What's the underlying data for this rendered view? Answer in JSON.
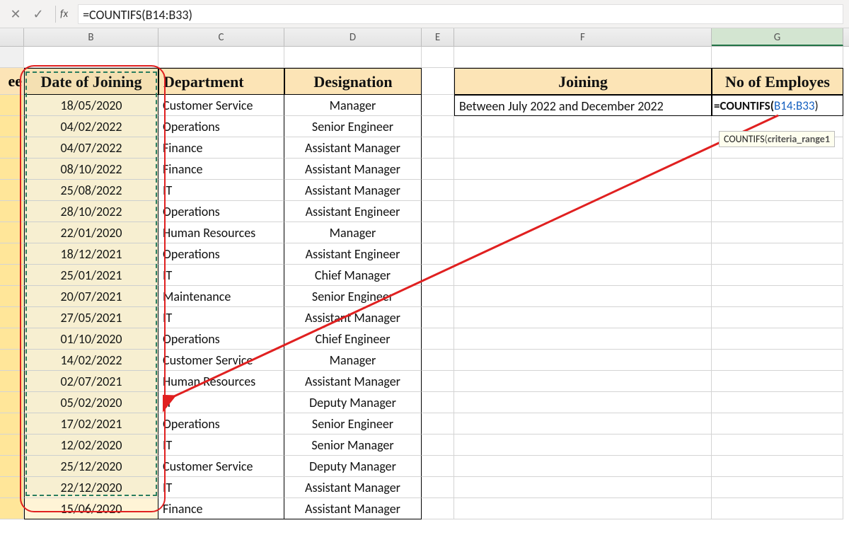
{
  "formula_bar": {
    "fx_label": "fx",
    "formula": "=COUNTIFS(B14:B33)"
  },
  "columns": [
    "B",
    "C",
    "D",
    "E",
    "F",
    "G"
  ],
  "headers": {
    "a_partial": "ee",
    "b": "Date of Joining",
    "c": "Department",
    "d": "Designation",
    "f": "Joining",
    "g": "No of Employes"
  },
  "side_table": {
    "f_value": "Between July 2022 and December 2022",
    "g_formula_prefix": "=COUNTIFS(",
    "g_formula_range": "B14:B33",
    "g_formula_suffix": ")"
  },
  "tooltip": {
    "fn": "COUNTIFS",
    "args": "(criteria_range1"
  },
  "rows": [
    {
      "date": "18/05/2020",
      "dept": "Customer Service",
      "desig": "Manager"
    },
    {
      "date": "04/02/2022",
      "dept": "Operations",
      "desig": "Senior Engineer"
    },
    {
      "date": "04/07/2022",
      "dept": "Finance",
      "desig": "Assistant Manager"
    },
    {
      "date": "08/10/2022",
      "dept": "Finance",
      "desig": "Assistant Manager"
    },
    {
      "date": "25/08/2022",
      "dept": "IT",
      "desig": "Assistant Manager"
    },
    {
      "date": "28/10/2022",
      "dept": "Operations",
      "desig": "Assistant Engineer"
    },
    {
      "date": "22/01/2020",
      "dept": "Human Resources",
      "desig": "Manager"
    },
    {
      "date": "18/12/2021",
      "dept": "Operations",
      "desig": "Assistant Engineer"
    },
    {
      "date": "25/01/2021",
      "dept": "IT",
      "desig": "Chief Manager"
    },
    {
      "date": "20/07/2021",
      "dept": "Maintenance",
      "desig": "Senior Engineer"
    },
    {
      "date": "27/05/2021",
      "dept": "IT",
      "desig": "Assistant Manager"
    },
    {
      "date": "01/10/2020",
      "dept": "Operations",
      "desig": "Chief Engineer"
    },
    {
      "date": "14/02/2022",
      "dept": "Customer Service",
      "desig": "Manager"
    },
    {
      "date": "02/07/2021",
      "dept": "Human Resources",
      "desig": "Assistant Manager"
    },
    {
      "date": "05/02/2020",
      "dept": "IT",
      "desig": "Deputy Manager"
    },
    {
      "date": "17/02/2021",
      "dept": "Operations",
      "desig": "Senior Engineer"
    },
    {
      "date": "12/02/2020",
      "dept": "IT",
      "desig": "Senior Manager"
    },
    {
      "date": "25/12/2020",
      "dept": "Customer Service",
      "desig": "Deputy Manager"
    },
    {
      "date": "22/12/2020",
      "dept": "IT",
      "desig": "Assistant Manager"
    },
    {
      "date": "15/06/2020",
      "dept": "Finance",
      "desig": "Assistant Manager"
    }
  ]
}
